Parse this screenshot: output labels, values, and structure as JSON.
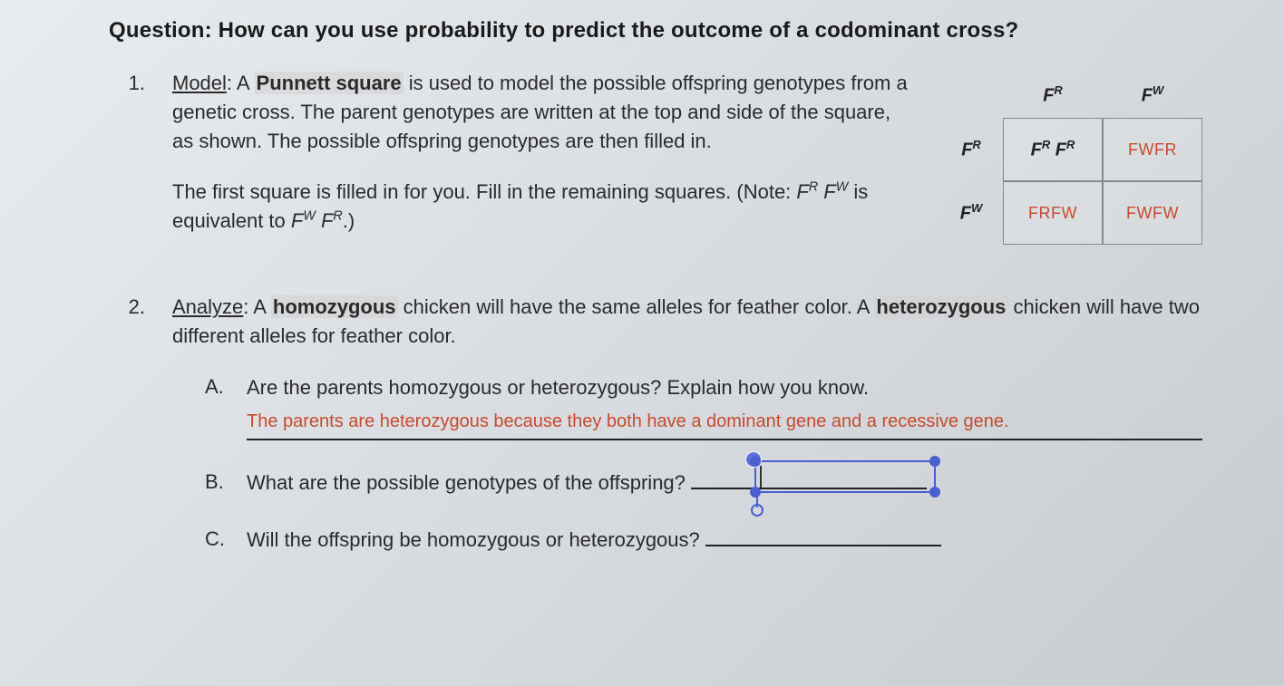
{
  "title": "Question: How can you use probability to predict the outcome of a codominant cross?",
  "q1": {
    "number": "1.",
    "heading_underline": "Model",
    "bold_term": "Punnett square",
    "para1_a": ": A ",
    "para1_b": " is used to model the possible offspring genotypes from a genetic cross. The parent genotypes are written at the top and side of the square, as shown. The possible offspring genotypes are then filled in.",
    "para2_a": "The first square is filled in for you. Fill in the remaining squares. (Note: ",
    "para2_note_mid": " is equivalent to ",
    "para2_end": ".)"
  },
  "punnett": {
    "col1": "F",
    "col1_sup": "R",
    "col2": "F",
    "col2_sup": "W",
    "row1": "F",
    "row1_sup": "R",
    "row2": "F",
    "row2_sup": "W",
    "cell11_a": "F",
    "cell11_a_sup": "R",
    "cell11_b": " F",
    "cell11_b_sup": "R",
    "cell12": "FWFR",
    "cell21": "FRFW",
    "cell22": "FWFW"
  },
  "q2": {
    "number": "2.",
    "heading_underline": "Analyze",
    "bold1": "homozygous",
    "bold2": "heterozygous",
    "para_a": ": A ",
    "para_b": " chicken will have the same alleles for feather color. A ",
    "para_c": " chicken will have two different alleles for feather color.",
    "A": {
      "label": "A.",
      "q": "Are the parents homozygous or heterozygous? Explain how you know.",
      "answer": "The parents are heterozygous because they both have a dominant gene and a recessive gene."
    },
    "B": {
      "label": "B.",
      "q": "What are the possible genotypes of the offspring?"
    },
    "C": {
      "label": "C.",
      "q": "Will the offspring be homozygous or heterozygous?"
    }
  },
  "note_genotypes": {
    "g1a": "F",
    "g1a_s": "R",
    "g1b": " F",
    "g1b_s": "W",
    "g2a": "F",
    "g2a_s": "W",
    "g2b": " F",
    "g2b_s": "R"
  },
  "icons": {
    "close": "×"
  }
}
